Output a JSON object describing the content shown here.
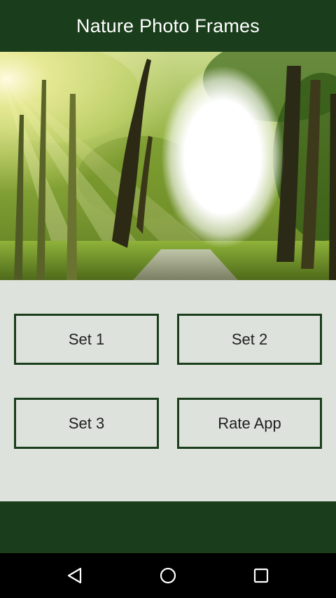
{
  "app": {
    "title": "Nature Photo Frames"
  },
  "banner": {
    "image": "forest-sunlight-photo-frame"
  },
  "buttons": {
    "set1": "Set 1",
    "set2": "Set 2",
    "set3": "Set 3",
    "rate": "Rate App"
  },
  "nav": {
    "back_icon": "back-icon",
    "home_icon": "home-icon",
    "recents_icon": "recents-icon"
  },
  "colors": {
    "primary": "#1a3d1c",
    "background": "#dde3dc",
    "nav": "#000000"
  }
}
